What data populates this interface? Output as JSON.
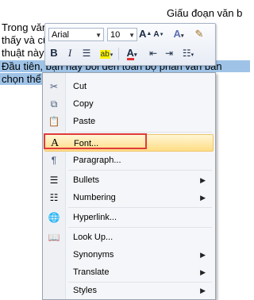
{
  "document": {
    "lines": [
      "Giấu đoạn văn b",
      "Trong văn bản Word đôi khi chúng ta",
      "thấy và cũng không muốn xóa văn bản",
      "thuật này"
    ],
    "selected_lines": [
      "Đầu tiên, bạn hãy bôi đen toàn bộ phần văn bản",
      "chọn thể"
    ]
  },
  "mini_toolbar": {
    "font_name": "Arial",
    "font_size": "10",
    "grow_font": "A",
    "shrink_font": "A",
    "bold": "B",
    "italic": "I",
    "font_color_letter": "A"
  },
  "context_menu": {
    "items": [
      {
        "label": "Cut",
        "icon": "scissors-icon"
      },
      {
        "label": "Copy",
        "icon": "copy-icon"
      },
      {
        "label": "Paste",
        "icon": "paste-icon"
      },
      {
        "label": "Font...",
        "icon": "font-icon"
      },
      {
        "label": "Paragraph...",
        "icon": "paragraph-icon"
      },
      {
        "label": "Bullets",
        "icon": "bullets-icon",
        "submenu": "▶"
      },
      {
        "label": "Numbering",
        "icon": "numbering-icon",
        "submenu": "▶"
      },
      {
        "label": "Hyperlink...",
        "icon": "hyperlink-icon"
      },
      {
        "label": "Look Up...",
        "icon": "lookup-icon"
      },
      {
        "label": "Synonyms",
        "submenu": "▶"
      },
      {
        "label": "Translate",
        "submenu": "▶"
      },
      {
        "label": "Styles",
        "submenu": "▶"
      }
    ],
    "highlight_color": "#e03b3b"
  }
}
